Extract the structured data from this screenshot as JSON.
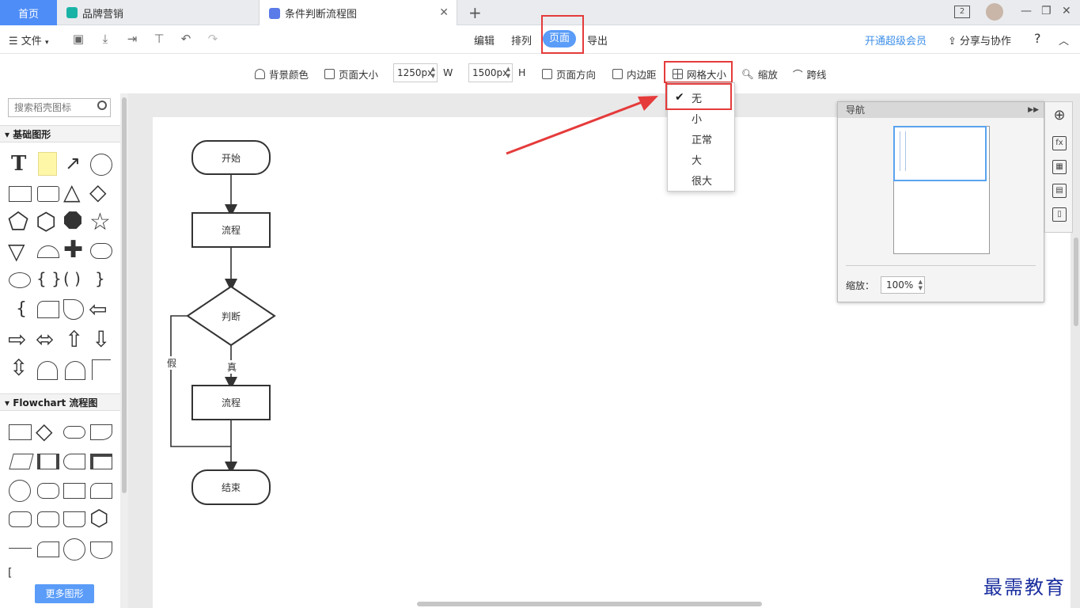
{
  "tabs": {
    "home": "首页",
    "tab1": "品牌营销",
    "tab2": "条件判断流程图",
    "window_badge": "2"
  },
  "menubar": {
    "file": "文件",
    "edit": "编辑",
    "arrange": "排列",
    "page": "页面",
    "export": "导出",
    "vip": "开通超级会员",
    "share": "分享与协作",
    "help": "?"
  },
  "toolbar": {
    "bg_color": "背景颜色",
    "page_size": "页面大小",
    "width_value": "1250px",
    "width_label": "W",
    "height_value": "1500px",
    "height_label": "H",
    "orientation": "页面方向",
    "padding": "内边距",
    "grid_size": "网格大小",
    "zoom": "缩放",
    "jump_line": "跨线"
  },
  "grid_dropdown": {
    "options": [
      "无",
      "小",
      "正常",
      "大",
      "很大"
    ],
    "selected": "无"
  },
  "left_panel": {
    "search_placeholder": "搜索稻壳图标",
    "section_basic": "基础图形",
    "section_flowchart": "Flowchart 流程图",
    "more_shapes": "更多图形"
  },
  "flowchart": {
    "start": "开始",
    "process1": "流程",
    "decision": "判断",
    "true_label": "真",
    "false_label": "假",
    "process2": "流程",
    "end": "结束"
  },
  "navigator": {
    "title": "导航",
    "zoom_label": "缩放：",
    "zoom_value": "100%"
  },
  "watermark": "最需教育",
  "colors": {
    "accent": "#5a9cf8",
    "highlight_red": "#e53b3b",
    "tab_home": "#4e8df7",
    "vip_blue": "#3d8fe8"
  }
}
